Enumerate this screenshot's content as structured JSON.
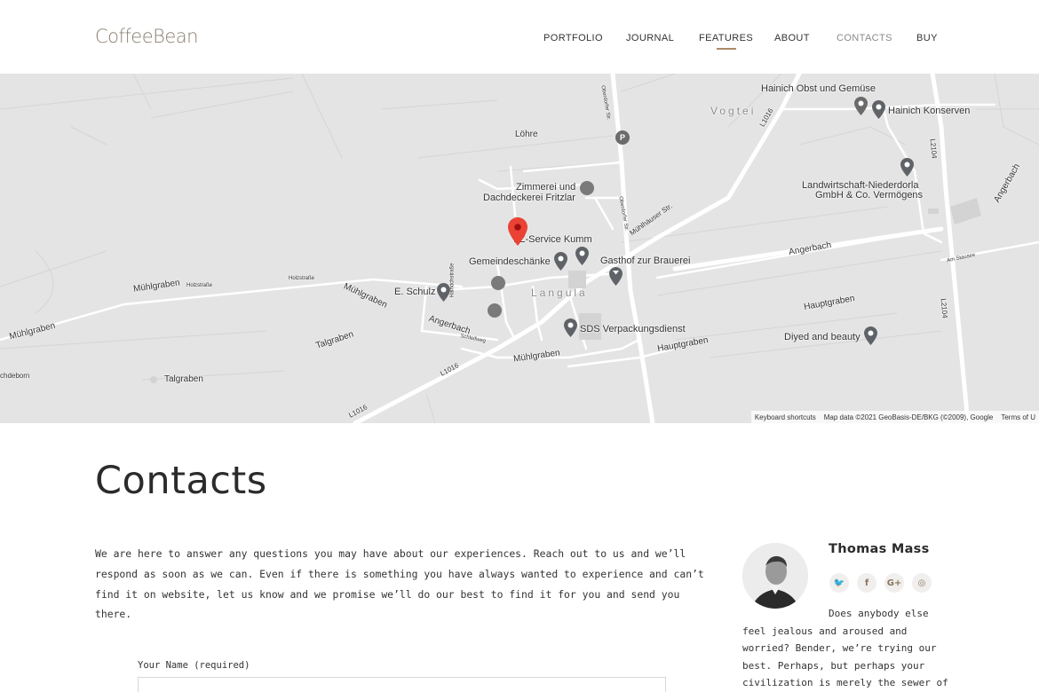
{
  "brand": {
    "logo": "CoffeeBean"
  },
  "nav": {
    "items": [
      {
        "label": "PORTFOLIO"
      },
      {
        "label": "JOURNAL"
      },
      {
        "label": "FEATURES"
      },
      {
        "label": "ABOUT"
      },
      {
        "label": "CONTACTS"
      },
      {
        "label": "BUY"
      }
    ],
    "active": "CONTACTS",
    "hovered": "FEATURES"
  },
  "map": {
    "places": [
      "Hainich Obst und Gemüse",
      "Hainich Konserven",
      "Vogtei",
      "Löhre",
      "Zimmerei und",
      "Dachdeckerei Fritzlar",
      "Landwirtschaft-Niederdorla",
      "GmbH & Co. Vermögens",
      "I-Z-Service Kumm",
      "Gemeindeschänke",
      "Gasthof zur Brauerei",
      "E. Schulz",
      "Langula",
      "SDS Verpackungsdienst",
      "Diyed and beauty",
      "Angerbach",
      "Hauptgraben",
      "Mühlgraben",
      "Talgraben",
      "Mühlhäuser Str.",
      "L1016",
      "L2104",
      "Oberdorfer Str.",
      "Holzstraße",
      "Haindchstraße",
      "Schleifweg",
      "Am Stausee",
      "chdeborn"
    ],
    "attribution": {
      "shortcuts": "Keyboard shortcuts",
      "data": "Map data ©2021 GeoBasis-DE/BKG (©2009), Google",
      "terms": "Terms of U"
    }
  },
  "page": {
    "title": "Contacts",
    "intro": "We are here to answer any questions you may have about our experiences. Reach out to us and we’ll respond as soon as we can. Even if there is something you have always wanted to experience and can’t find it on website, let us know and we promise we’ll do our best to find it for you and send you there."
  },
  "form": {
    "name_label": "Your Name (required)",
    "name_value": ""
  },
  "author": {
    "name": "Thomas Mass",
    "socials": [
      {
        "icon": "twitter-icon",
        "glyph": "🐦"
      },
      {
        "icon": "facebook-icon",
        "glyph": "f"
      },
      {
        "icon": "google-plus-icon",
        "glyph": "G+"
      },
      {
        "icon": "instagram-icon",
        "glyph": "◎"
      }
    ],
    "bio": "Does anybody else feel jealous and aroused and worried? Bender, we’re trying our best. Perhaps, but perhaps your civilization is merely the sewer of"
  },
  "colors": {
    "accent": "#b08a6a",
    "map_bg": "#e5e4e4",
    "pin_red": "#ea4335",
    "pin_gray": "#5f6368"
  }
}
